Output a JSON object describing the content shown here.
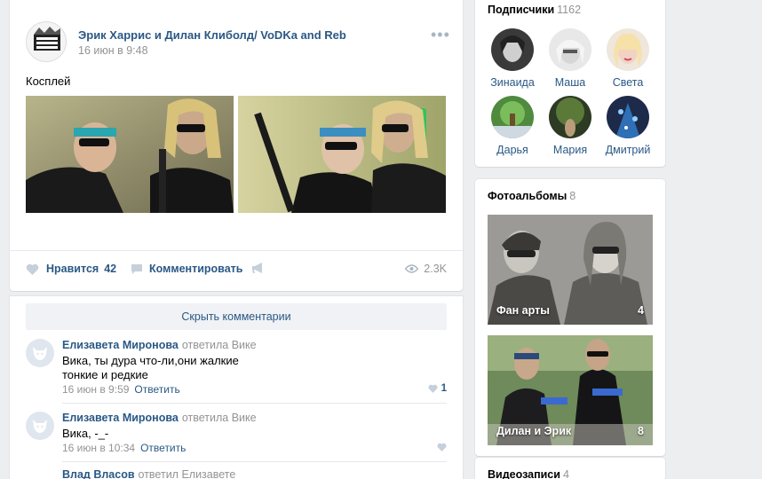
{
  "post": {
    "author": "Эрик Харрис и Дилан Клиболд/ VoDKa and Reb",
    "time": "16 июн в 9:48",
    "more": "•••",
    "text": "Косплей",
    "likes_label": "Нравится",
    "likes_count": "42",
    "comment_label": "Комментировать",
    "views": "2.3K"
  },
  "comments": {
    "hide_label": "Скрыть комментарии",
    "items": [
      {
        "name": "Елизавета Миронова",
        "reply": "ответила Вике",
        "line1": "Вика, ты дура что-ли,они жалкие",
        "line2": "тонкие и редкие",
        "date": "16 июн в 9:59",
        "answer": "Ответить",
        "likes": "1"
      },
      {
        "name": "Елизавета Миронова",
        "reply": "ответила Вике",
        "line1": "Вика, -_-",
        "date": "16 июн в 10:34",
        "answer": "Ответить"
      },
      {
        "name": "Влад Власов",
        "reply": "ответил Елизавете"
      }
    ]
  },
  "subscribers": {
    "title": "Подписчики",
    "count": "1162",
    "people": [
      "Зинаида",
      "Маша",
      "Света",
      "Дарья",
      "Мария",
      "Дмитрий"
    ]
  },
  "albums": {
    "title": "Фотоальбомы",
    "count": "8",
    "items": [
      {
        "name": "Фан арты",
        "count": "4"
      },
      {
        "name": "Дилан и Эрик",
        "count": "8"
      }
    ]
  },
  "videos": {
    "title": "Видеозаписи",
    "count": "4"
  },
  "colors": {
    "link": "#2a5885",
    "muted": "#939393",
    "background": "#edeef0",
    "icon": "#aab5c3",
    "like_icon": "#c5d0db"
  }
}
